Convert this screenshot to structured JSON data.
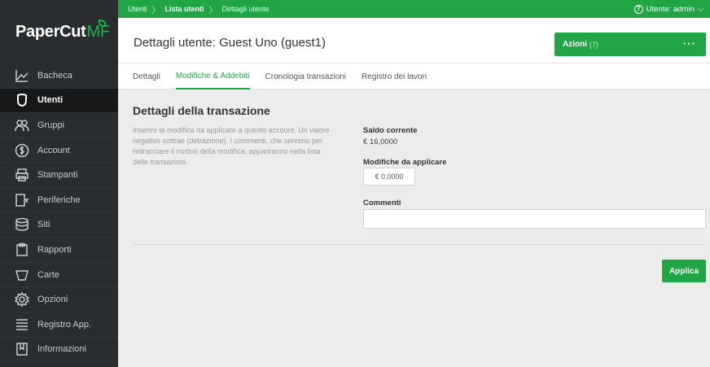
{
  "brand": {
    "name": "PaperCut",
    "suffix": "MF"
  },
  "colors": {
    "accent": "#22a545",
    "sidebar": "#2a2d30",
    "sidebar_active": "#16181a"
  },
  "sidebar": {
    "items": [
      {
        "label": "Bacheca",
        "icon": "chart-line-icon",
        "active": false
      },
      {
        "label": "Utenti",
        "icon": "user-icon",
        "active": true
      },
      {
        "label": "Gruppi",
        "icon": "group-icon",
        "active": false
      },
      {
        "label": "Account",
        "icon": "account-coin-icon",
        "active": false
      },
      {
        "label": "Stampanti",
        "icon": "printer-icon",
        "active": false
      },
      {
        "label": "Periferiche",
        "icon": "device-icon",
        "active": false
      },
      {
        "label": "Siti",
        "icon": "database-icon",
        "active": false
      },
      {
        "label": "Rapporti",
        "icon": "clipboard-icon",
        "active": false
      },
      {
        "label": "Carte",
        "icon": "card-icon",
        "active": false
      },
      {
        "label": "Opzioni",
        "icon": "gear-icon",
        "active": false
      },
      {
        "label": "Registro App.",
        "icon": "log-lines-icon",
        "active": false
      },
      {
        "label": "Informazioni",
        "icon": "info-book-icon",
        "active": false
      }
    ]
  },
  "breadcrumb": {
    "items": [
      "Utenti",
      "Lista utenti",
      "Dettagli utente"
    ]
  },
  "user_menu": {
    "label": "Utente: admin"
  },
  "header": {
    "title": "Dettagli utente: Guest Uno (guest1)"
  },
  "actions": {
    "label": "Azioni",
    "count": "(7)",
    "more": "···"
  },
  "tabs": [
    {
      "label": "Dettagli",
      "active": false
    },
    {
      "label": "Modifiche & Addebiti",
      "active": true
    },
    {
      "label": "Cronologia transazioni",
      "active": false
    },
    {
      "label": "Registro dei lavori",
      "active": false
    }
  ],
  "transaction": {
    "title": "Dettagli della transazione",
    "description": "Inserire la modifica da applicare a questo account. Un valore negativo sottrae (detrazione). I commenti, che servono per rintracciare il motivo della modifica, appariranno nella lista delle transazioni.",
    "balance_label": "Saldo corrente",
    "balance_value": "€ 16,0000",
    "adjust_label": "Modifiche da applicare",
    "adjust_value": "€ 0,0000",
    "comments_label": "Commenti",
    "comments_value": "",
    "apply_label": "Applica"
  }
}
